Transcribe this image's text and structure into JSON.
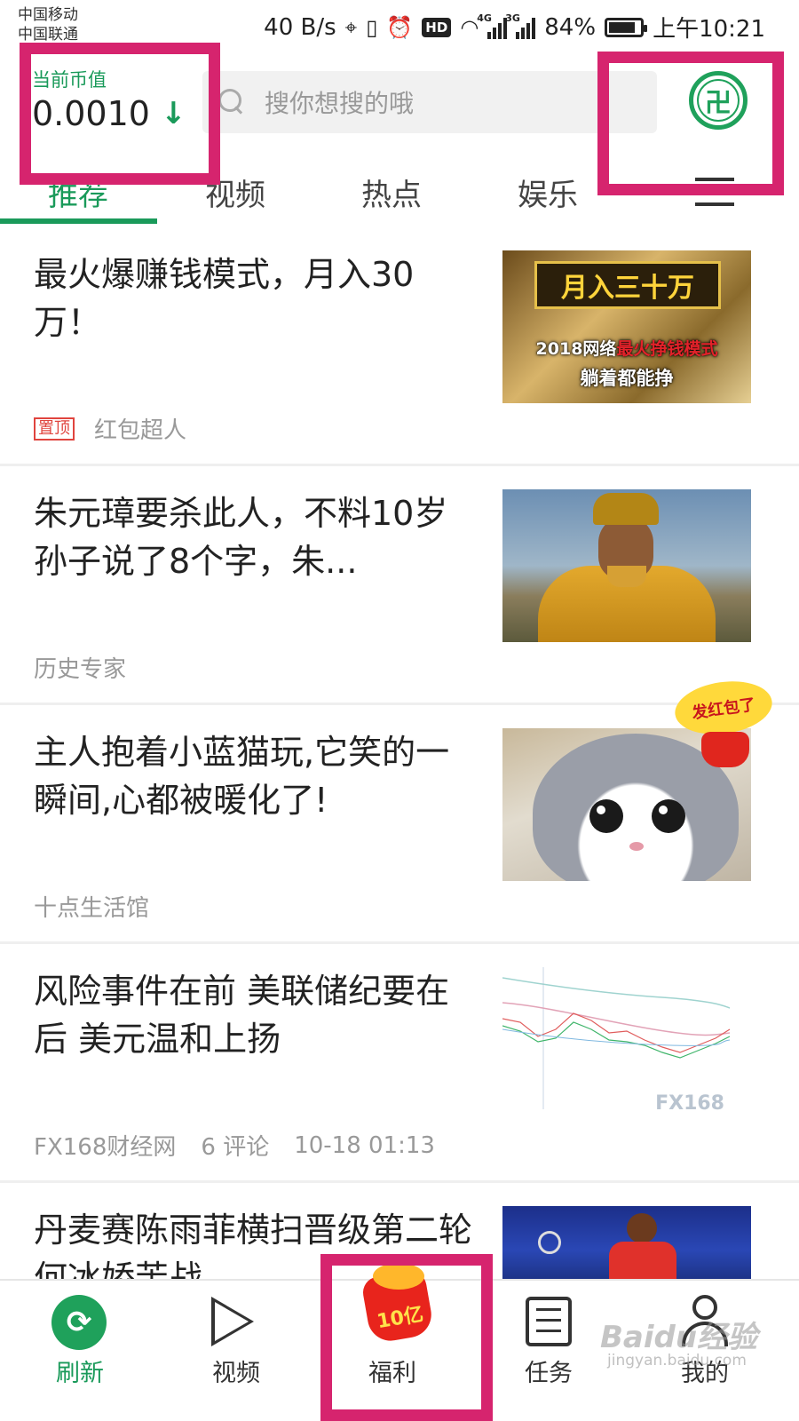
{
  "status_bar": {
    "carrier_1": "中国移动",
    "carrier_2": "中国联通",
    "net_speed": "40 B/s",
    "hd": "HD",
    "net_4g": "4G",
    "net_3g": "3G",
    "battery_percent": "84%",
    "battery_level": 0.84,
    "time": "上午10:21",
    "icons": [
      "location-icon",
      "vibrate-icon",
      "alarm-icon",
      "wifi-icon",
      "signal-icon",
      "battery-icon"
    ]
  },
  "header": {
    "coin_label": "当前币值",
    "coin_value": "0.0010",
    "coin_trend": "↓",
    "search_placeholder": "搜你想搜的哦",
    "wallet_glyph": "卍"
  },
  "tabs": [
    {
      "label": "推荐",
      "active": true
    },
    {
      "label": "视频",
      "active": false
    },
    {
      "label": "热点",
      "active": false
    },
    {
      "label": "娱乐",
      "active": false
    }
  ],
  "feed": [
    {
      "title": "最火爆赚钱模式，月入30万！",
      "pinned_label": "置顶",
      "source": "红包超人",
      "thumb_banner": "月入三十万",
      "thumb_sub_prefix": "2018网络",
      "thumb_sub_highlight": "最火挣钱模式",
      "thumb_sub2": "躺着都能挣"
    },
    {
      "title": "朱元璋要杀此人，不料10岁孙子说了8个字，朱...",
      "source": "历史专家"
    },
    {
      "title": "主人抱着小蓝猫玩,它笑的一瞬间,心都被暖化了!",
      "source": "十点生活馆",
      "sticker": "发红包了"
    },
    {
      "title": "风险事件在前 美联储纪要在后 美元温和上扬",
      "source": "FX168财经网",
      "comments": "6 评论",
      "time": "10-18 01:13",
      "thumb_watermark": "FX168"
    },
    {
      "title": "丹麦赛陈雨菲横扫晋级第二轮 何冰娇苦战..."
    }
  ],
  "bottom_nav": [
    {
      "label": "刷新",
      "icon": "refresh-icon",
      "active": true
    },
    {
      "label": "视频",
      "icon": "video-play-icon",
      "active": false
    },
    {
      "label": "福利",
      "icon": "red-packet-icon",
      "badge": "10亿",
      "active": false
    },
    {
      "label": "任务",
      "icon": "task-list-icon",
      "active": false
    },
    {
      "label": "我的",
      "icon": "profile-icon",
      "active": false
    }
  ],
  "watermark": {
    "brand": "Baidu经验",
    "url": "jingyan.baidu.com"
  },
  "colors": {
    "accent": "#1a9a5a",
    "highlight_box": "#d6246e",
    "pin_red": "#e0443e"
  }
}
